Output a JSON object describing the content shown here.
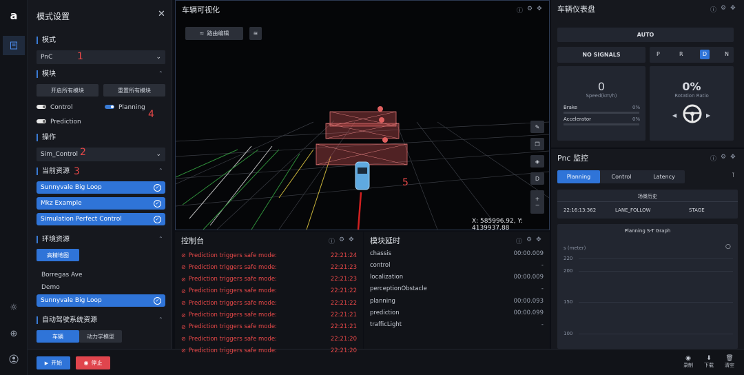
{
  "rail": {
    "logo": "a",
    "icons": [
      "panel-icon",
      "sun-icon",
      "crosshair-icon",
      "user-icon"
    ]
  },
  "sidebar": {
    "title": "模式设置",
    "mode": {
      "label": "模式",
      "value": "PnC",
      "annotation": "1"
    },
    "modules": {
      "label": "模块",
      "open_all": "开启所有模块",
      "reset_all": "重置所有模块",
      "items": [
        {
          "label": "Control",
          "on": false
        },
        {
          "label": "Planning",
          "on": true
        },
        {
          "label": "Prediction",
          "on": false
        }
      ],
      "annotation": "4"
    },
    "operation": {
      "label": "操作",
      "value": "Sim_Control",
      "annotation": "2"
    },
    "resources": {
      "label": "当前资源",
      "annotation": "3",
      "items": [
        "Sunnyvale Big Loop",
        "Mkz Example",
        "Simulation Perfect Control"
      ]
    },
    "env": {
      "label": "环境资源",
      "hd_map": "高精地图",
      "maps": [
        "Borregas Ave",
        "Demo",
        "Sunnyvale Big Loop"
      ]
    },
    "ad_resources": {
      "label": "自动驾驶系统资源",
      "tabs": [
        "车辆",
        "动力学模型"
      ]
    }
  },
  "bottombar": {
    "start": "开始",
    "stop": "停止",
    "record": "录制",
    "download": "下载",
    "clear": "清空"
  },
  "viz": {
    "title": "车辆可视化",
    "route_edit": "路由编辑",
    "coords": "X: 585996.92, Y: 4139937.88",
    "annotation": "5",
    "tool_d": "D",
    "zoom_in": "+",
    "zoom_out": "−"
  },
  "console": {
    "title": "控制台",
    "rows": [
      {
        "msg": "Prediction triggers safe mode:",
        "time": "22:21:24"
      },
      {
        "msg": "Prediction triggers safe mode:",
        "time": "22:21:23"
      },
      {
        "msg": "Prediction triggers safe mode:",
        "time": "22:21:23"
      },
      {
        "msg": "Prediction triggers safe mode:",
        "time": "22:21:22"
      },
      {
        "msg": "Prediction triggers safe mode:",
        "time": "22:21:22"
      },
      {
        "msg": "Prediction triggers safe mode:",
        "time": "22:21:21"
      },
      {
        "msg": "Prediction triggers safe mode:",
        "time": "22:21:21"
      },
      {
        "msg": "Prediction triggers safe mode:",
        "time": "22:21:20"
      },
      {
        "msg": "Prediction triggers safe mode:",
        "time": "22:21:20"
      }
    ]
  },
  "latency": {
    "title": "模块延时",
    "rows": [
      {
        "name": "chassis",
        "value": "00:00.009"
      },
      {
        "name": "control",
        "value": "-"
      },
      {
        "name": "localization",
        "value": "00:00.009"
      },
      {
        "name": "perceptionObstacle",
        "value": "-"
      },
      {
        "name": "planning",
        "value": "00:00.093"
      },
      {
        "name": "prediction",
        "value": "00:00.099"
      },
      {
        "name": "trafficLight",
        "value": "-"
      }
    ]
  },
  "dash": {
    "title": "车辆仪表盘",
    "mode": "AUTO",
    "signals": "NO SIGNALS",
    "gears": [
      "P",
      "R",
      "D",
      "N"
    ],
    "active_gear": "D",
    "speed": "0",
    "speed_label": "Speed(km/h)",
    "brake_label": "Brake",
    "brake": "0%",
    "accel_label": "Accelerator",
    "accel": "0%",
    "rotation": "0%",
    "rotation_label": "Rotation Ratio"
  },
  "pnc": {
    "title": "Pnc 监控",
    "tabs": [
      "Planning",
      "Control",
      "Latency"
    ],
    "history_title": "场景历史",
    "history_row": [
      "22:16:13:362",
      "LANE_FOLLOW",
      "STAGE"
    ],
    "graph_title": "Planning S-T Graph",
    "graph_ylabel": "s (meter)",
    "ticks": [
      "220",
      "200",
      "150",
      "100"
    ]
  }
}
